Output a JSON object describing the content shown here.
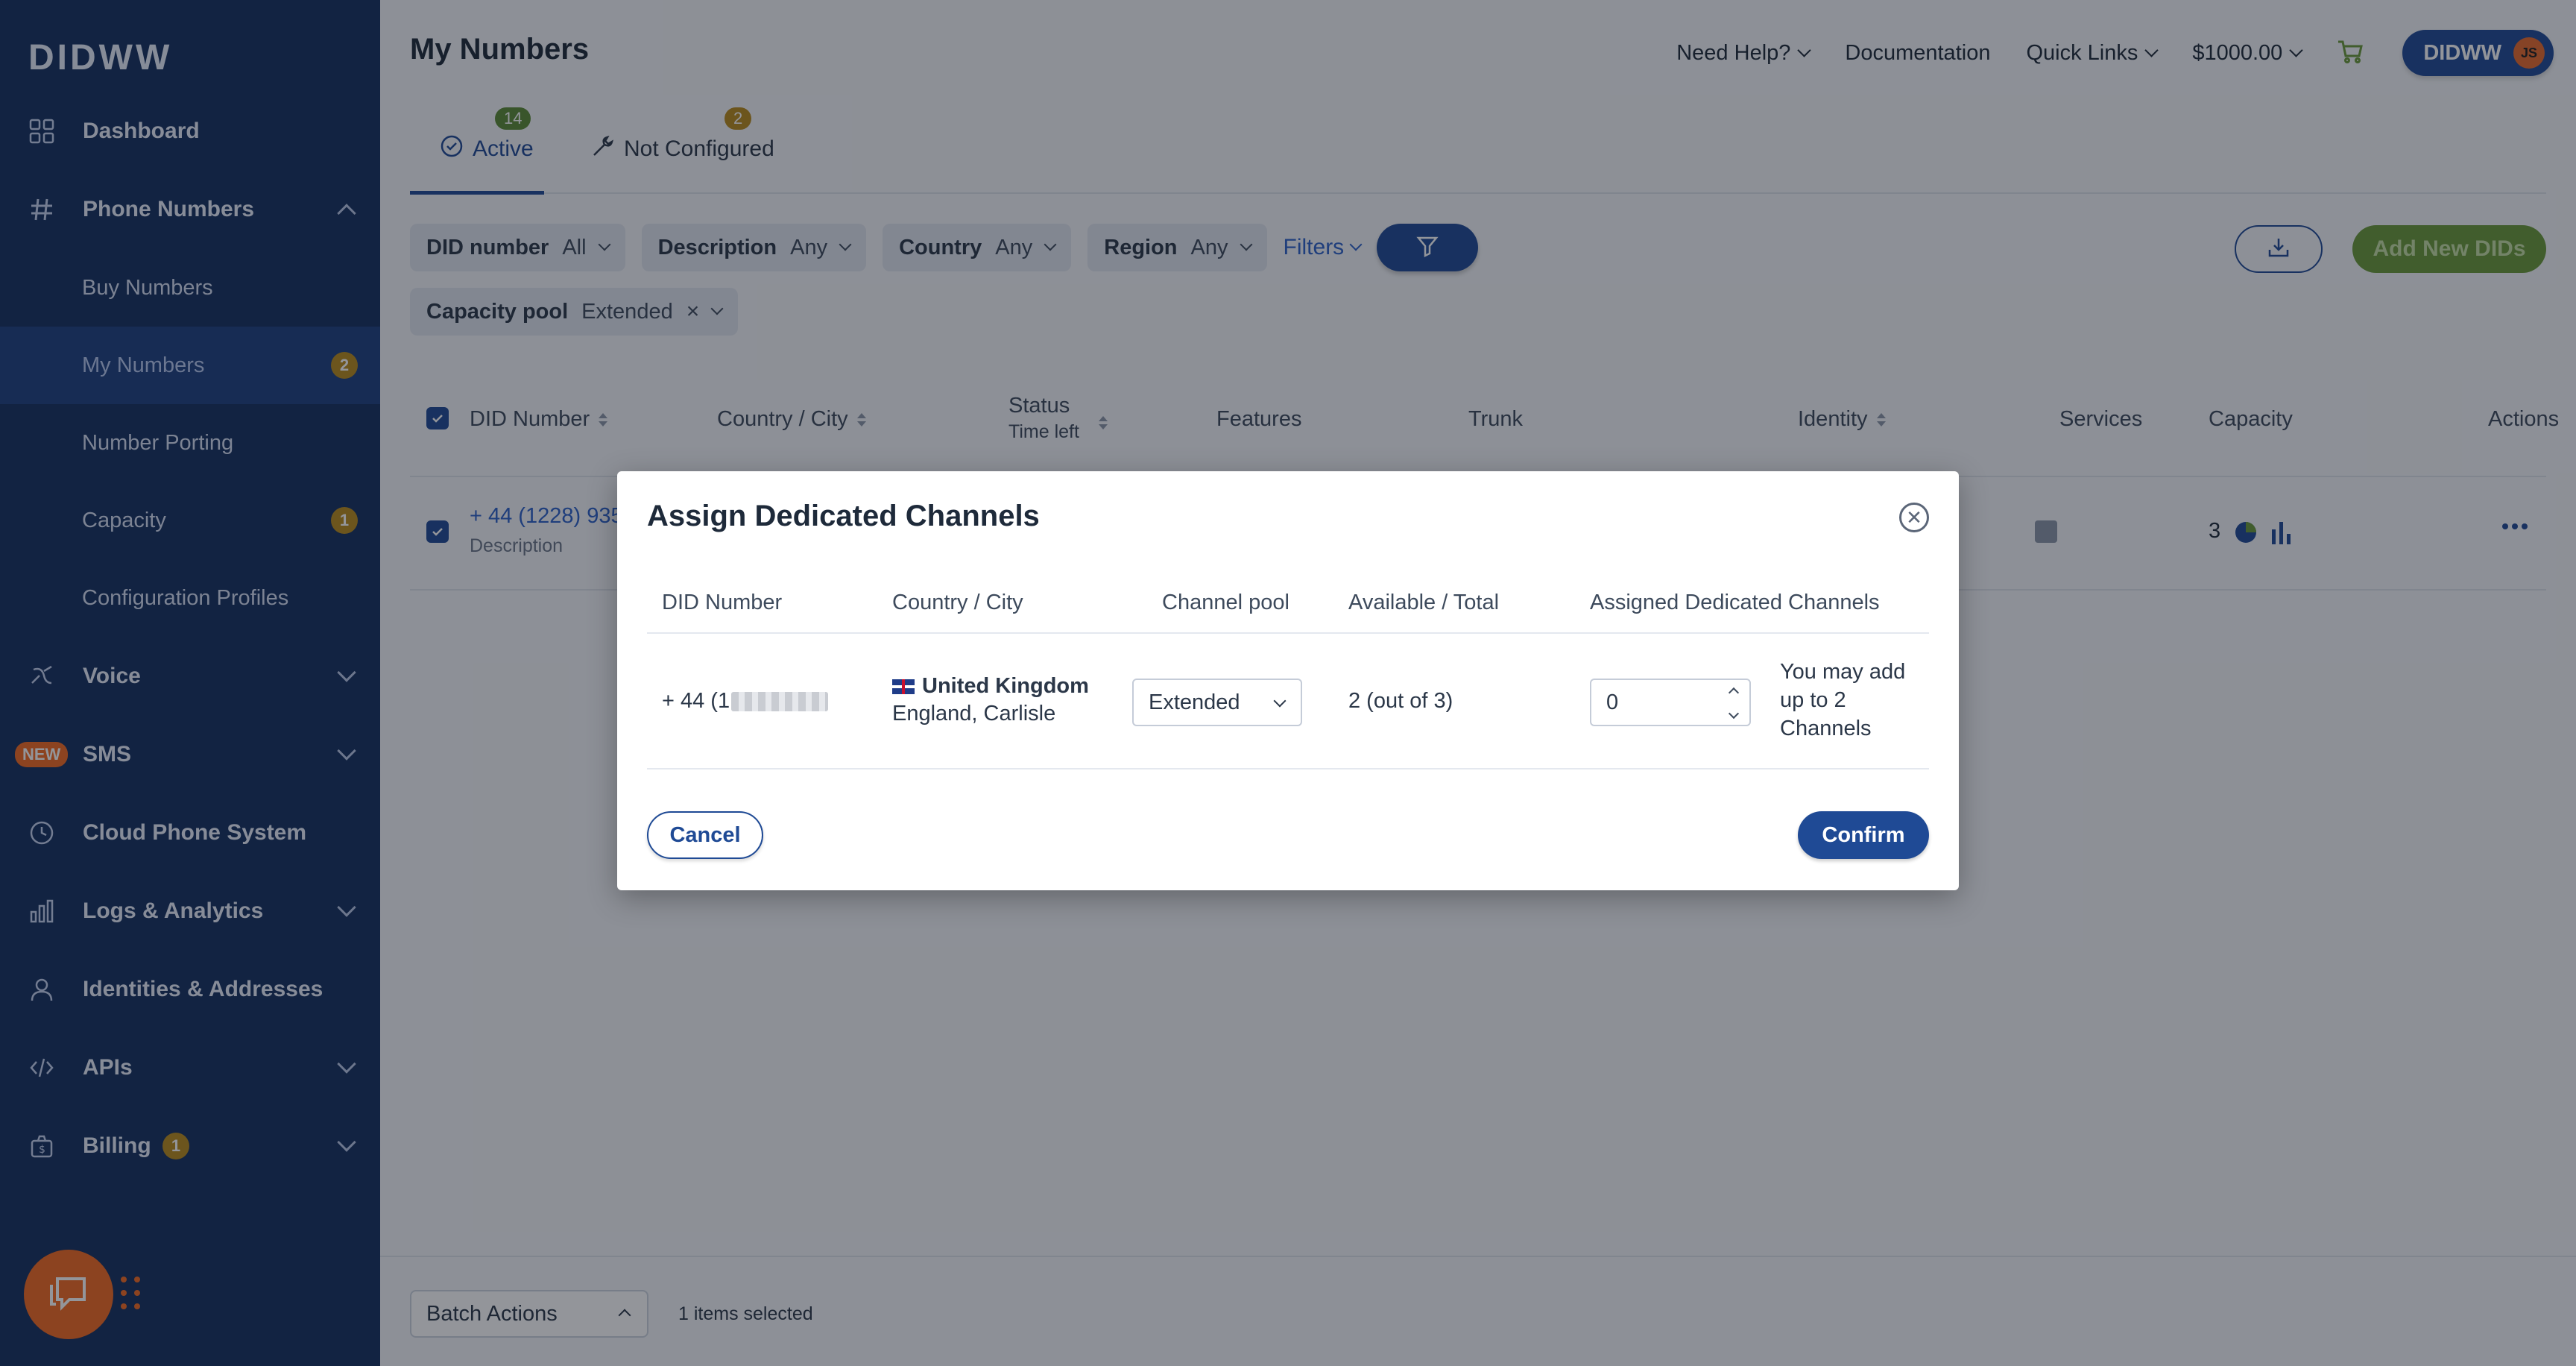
{
  "sidebar": {
    "logo": "DIDWW",
    "items": [
      {
        "label": "Dashboard",
        "icon": "grid-icon"
      },
      {
        "label": "Phone Numbers",
        "icon": "hash-icon"
      },
      {
        "label": "Voice",
        "icon": "voice-icon"
      },
      {
        "label": "SMS",
        "icon": "sms-icon",
        "tag": "NEW"
      },
      {
        "label": "Cloud Phone System",
        "icon": "clock-icon"
      },
      {
        "label": "Logs & Analytics",
        "icon": "bar-chart-icon"
      },
      {
        "label": "Identities & Addresses",
        "icon": "person-icon"
      },
      {
        "label": "APIs",
        "icon": "code-icon"
      },
      {
        "label": "Billing",
        "icon": "money-bag-icon",
        "badge": "1"
      }
    ],
    "sub_items": [
      {
        "label": "Buy Numbers"
      },
      {
        "label": "My Numbers",
        "badge": "2"
      },
      {
        "label": "Number Porting"
      },
      {
        "label": "Capacity",
        "badge": "1"
      },
      {
        "label": "Configuration Profiles"
      }
    ]
  },
  "header": {
    "title": "My Numbers",
    "need_help": "Need Help?",
    "documentation": "Documentation",
    "quick_links": "Quick Links",
    "balance": "$1000.00",
    "account": "DIDWW",
    "avatar_initials": "JS"
  },
  "tabs": [
    {
      "label": "Active",
      "count": "14"
    },
    {
      "label": "Not Configured",
      "count": "2"
    }
  ],
  "filters": {
    "did_number": {
      "label": "DID number",
      "value": "All"
    },
    "description": {
      "label": "Description",
      "value": "Any"
    },
    "country": {
      "label": "Country",
      "value": "Any"
    },
    "region": {
      "label": "Region",
      "value": "Any"
    },
    "filters_link": "Filters",
    "capacity_pool": {
      "label": "Capacity pool",
      "value": "Extended",
      "clear": "×"
    }
  },
  "actions": {
    "add_new": "Add New DIDs"
  },
  "table": {
    "columns": {
      "did_number": "DID Number",
      "country_city": "Country / City",
      "status": "Status",
      "time_left": "Time left",
      "features": "Features",
      "trunk": "Trunk",
      "identity": "Identity",
      "services": "Services",
      "capacity": "Capacity",
      "actions": "Actions"
    },
    "row": {
      "number": "+ 44 (1228) 935",
      "description": "Description",
      "capacity": "3"
    }
  },
  "bottom": {
    "batch_actions": "Batch Actions",
    "selected": "1 items selected"
  },
  "modal": {
    "title": "Assign Dedicated Channels",
    "columns": {
      "did_number": "DID Number",
      "country_city": "Country / City",
      "channel_pool": "Channel pool",
      "available_total": "Available / Total",
      "assigned": "Assigned Dedicated Channels"
    },
    "row": {
      "number_prefix": "+ 44 (1",
      "country": "United Kingdom",
      "city": "England, Carlisle",
      "channel_pool": "Extended",
      "available_total": "2 (out of 3)",
      "assigned_value": "0",
      "hint": "You may add up to 2 Channels"
    },
    "cancel": "Cancel",
    "confirm": "Confirm"
  },
  "colors": {
    "sidebar": "#14305f",
    "primary": "#1f4a95",
    "accent_orange": "#f26a21",
    "green": "#6a9a3a"
  }
}
